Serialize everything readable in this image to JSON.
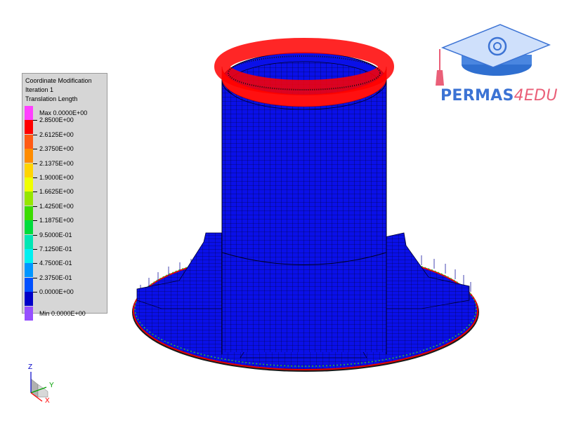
{
  "legend": {
    "title_lines": [
      "Coordinate Modification",
      "Iteration 1",
      "Translation Length"
    ],
    "entries": [
      {
        "label": "Max 0.0000E+00",
        "color": "#ff40ff"
      },
      {
        "label": "2.8500E+00",
        "color": "#ff0000"
      },
      {
        "label": "2.6125E+00",
        "color": "#ff5a14"
      },
      {
        "label": "2.3750E+00",
        "color": "#ff8c00"
      },
      {
        "label": "2.1375E+00",
        "color": "#ffd400"
      },
      {
        "label": "1.9000E+00",
        "color": "#f0ff00"
      },
      {
        "label": "1.6625E+00",
        "color": "#96e600"
      },
      {
        "label": "1.4250E+00",
        "color": "#3cdc00"
      },
      {
        "label": "1.1875E+00",
        "color": "#00dc3c"
      },
      {
        "label": "9.5000E-01",
        "color": "#00e6b4"
      },
      {
        "label": "7.1250E-01",
        "color": "#00f0f0"
      },
      {
        "label": "4.7500E-01",
        "color": "#0096ff"
      },
      {
        "label": "2.3750E-01",
        "color": "#0050ff"
      },
      {
        "label": "0.0000E+00",
        "color": "#0000c8"
      },
      {
        "label": "Min 0.0000E+00",
        "color": "#9650ff"
      }
    ]
  },
  "logo": {
    "part1": "PERMAS",
    "part2": "4EDU"
  },
  "triad": {
    "z": "Z",
    "y": "Y",
    "x": "X"
  },
  "model": {
    "mesh_color": "#0000e6",
    "arrow_color": "#ff0000"
  }
}
